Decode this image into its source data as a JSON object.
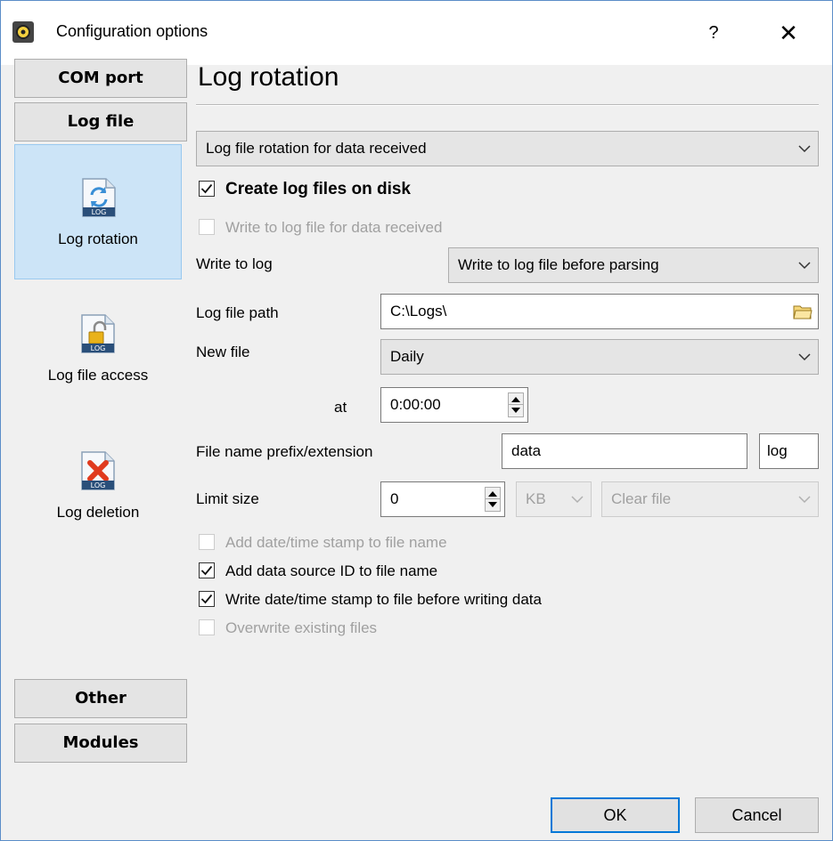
{
  "window": {
    "title": "Configuration options",
    "help_label": "?",
    "close_label": "✕",
    "app_icon": "settings-app-icon"
  },
  "sidebar": {
    "categories_top": [
      "COM port",
      "Log file"
    ],
    "items": [
      {
        "label": "Log rotation",
        "icon": "log-rotation-icon",
        "selected": true
      },
      {
        "label": "Log file access",
        "icon": "log-file-access-icon",
        "selected": false
      },
      {
        "label": "Log deletion",
        "icon": "log-deletion-icon",
        "selected": false
      }
    ],
    "icon_badge": "LOG",
    "categories_bottom": [
      "Other",
      "Modules"
    ]
  },
  "panel": {
    "heading": "Log rotation",
    "rotation_select": "Log file rotation for data received",
    "create_log_files": {
      "label": "Create log files on disk",
      "checked": true,
      "enabled": true
    },
    "write_data_received": {
      "label": "Write to log file for data received",
      "checked": false,
      "enabled": false
    },
    "write_to_log": {
      "label": "Write to log",
      "value": "Write to log file before parsing"
    },
    "log_file_path": {
      "label": "Log file path",
      "value": "C:\\Logs\\"
    },
    "new_file": {
      "label": "New file",
      "value": "Daily"
    },
    "at_time": {
      "label": "at",
      "value": "0:00:00"
    },
    "file_name": {
      "label": "File name prefix/extension",
      "prefix": "data",
      "extension": "log"
    },
    "limit_size": {
      "label": "Limit size",
      "value": "0",
      "unit": "KB",
      "action": "Clear file"
    },
    "options": [
      {
        "label": "Add date/time stamp to file name",
        "checked": false,
        "enabled": false
      },
      {
        "label": "Add data source ID to file name",
        "checked": true,
        "enabled": true
      },
      {
        "label": "Write date/time stamp to file before writing data",
        "checked": true,
        "enabled": true
      },
      {
        "label": "Overwrite existing files",
        "checked": false,
        "enabled": false
      }
    ]
  },
  "footer": {
    "ok_label": "OK",
    "cancel_label": "Cancel"
  },
  "colors": {
    "accent": "#0078d7",
    "selected_bg": "#cce4f7",
    "selected_border": "#99c9ef",
    "log_badge": "#2a4f7a",
    "delete_x": "#e03a1e"
  }
}
